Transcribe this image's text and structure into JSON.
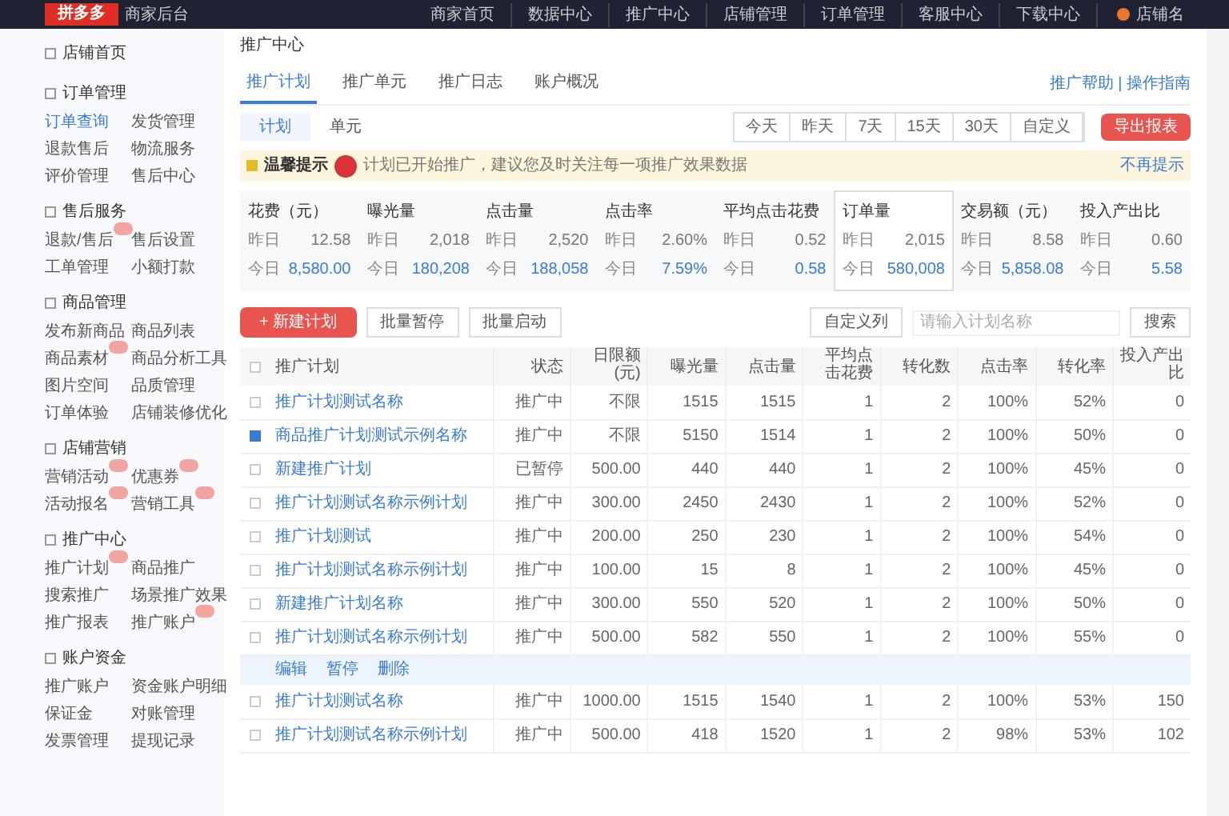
{
  "topbar": {
    "logo": "拼多多",
    "subtitle": "商家后台",
    "nav": [
      "商家首页",
      "数据中心",
      "推广中心",
      "店铺管理",
      "订单管理",
      "客服中心",
      "下载中心"
    ],
    "user": "店铺名"
  },
  "sidebar": {
    "groups": [
      {
        "title": "店铺首页"
      },
      {
        "title": "订单管理",
        "items": [
          {
            "label": "订单查询",
            "selected": true,
            "badge": false
          },
          {
            "label": "发货管理",
            "selected": false,
            "badge": false
          },
          {
            "label": "退款售后",
            "selected": false,
            "badge": false
          },
          {
            "label": "物流服务",
            "selected": false,
            "badge": false
          },
          {
            "label": "评价管理",
            "selected": false,
            "badge": false
          },
          {
            "label": "售后中心",
            "selected": false,
            "badge": false
          }
        ]
      },
      {
        "title": "售后服务",
        "items": [
          {
            "label": "退款/售后",
            "selected": false,
            "badge": true
          },
          {
            "label": "售后设置",
            "selected": false,
            "badge": false
          },
          {
            "label": "工单管理",
            "selected": false,
            "badge": false
          },
          {
            "label": "小额打款",
            "selected": false,
            "badge": false
          }
        ]
      },
      {
        "title": "商品管理",
        "items": [
          {
            "label": "发布新商品",
            "selected": false,
            "badge": false
          },
          {
            "label": "商品列表",
            "selected": false,
            "badge": false
          },
          {
            "label": "商品素材",
            "selected": false,
            "badge": true
          },
          {
            "label": "商品分析工具",
            "selected": false,
            "badge": false
          },
          {
            "label": "图片空间",
            "selected": false,
            "badge": false
          },
          {
            "label": "品质管理",
            "selected": false,
            "badge": false
          },
          {
            "label": "订单体验",
            "selected": false,
            "badge": false
          },
          {
            "label": "店铺装修优化",
            "selected": false,
            "badge": false
          }
        ]
      },
      {
        "title": "店铺营销",
        "items": [
          {
            "label": "营销活动",
            "selected": false,
            "badge": true
          },
          {
            "label": "优惠券",
            "selected": false,
            "badge": true
          },
          {
            "label": "活动报名",
            "selected": false,
            "badge": true
          },
          {
            "label": "营销工具",
            "selected": false,
            "badge": true
          }
        ]
      },
      {
        "title": "推广中心",
        "items": [
          {
            "label": "推广计划",
            "selected": false,
            "badge": true
          },
          {
            "label": "商品推广",
            "selected": false,
            "badge": false
          },
          {
            "label": "搜索推广",
            "selected": false,
            "badge": false
          },
          {
            "label": "场景推广效果",
            "selected": false,
            "badge": false
          },
          {
            "label": "推广报表",
            "selected": false,
            "badge": false
          },
          {
            "label": "推广账户",
            "selected": false,
            "badge": true
          }
        ]
      },
      {
        "title": "账户资金",
        "items": [
          {
            "label": "推广账户",
            "selected": false,
            "badge": false
          },
          {
            "label": "资金账户明细",
            "selected": false,
            "badge": false
          },
          {
            "label": "保证金",
            "selected": false,
            "badge": false
          },
          {
            "label": "对账管理",
            "selected": false,
            "badge": false
          },
          {
            "label": "发票管理",
            "selected": false,
            "badge": false
          },
          {
            "label": "提现记录",
            "selected": false,
            "badge": false
          }
        ]
      }
    ]
  },
  "breadcrumb": "推广中心",
  "tabs": [
    {
      "label": "推广计划",
      "selected": true
    },
    {
      "label": "推广单元",
      "selected": false
    },
    {
      "label": "推广日志",
      "selected": false
    },
    {
      "label": "账户概况",
      "selected": false
    }
  ],
  "help_link": "推广帮助 | 操作指南",
  "subtabs": [
    {
      "label": "计划",
      "selected": true
    },
    {
      "label": "单元",
      "selected": false
    }
  ],
  "date_ranges": [
    {
      "label": "今天",
      "selected": false
    },
    {
      "label": "昨天",
      "selected": false
    },
    {
      "label": "7天",
      "selected": false
    },
    {
      "label": "15天",
      "selected": false
    },
    {
      "label": "30天",
      "selected": false
    },
    {
      "label": "自定义",
      "selected": false
    }
  ],
  "export_button": "导出报表",
  "notice": {
    "title": "温馨提示",
    "text": "计划已开始推广，建议您及时关注每一项推广效果数据",
    "dismiss": "不再提示"
  },
  "metrics": [
    {
      "label": "花费（元）",
      "yesterday_label": "昨日",
      "yesterday": "12.58",
      "today_label": "今日",
      "today": "8,580.00",
      "selected": false
    },
    {
      "label": "曝光量",
      "yesterday_label": "昨日",
      "yesterday": "2,018",
      "today_label": "今日",
      "today": "180,208",
      "selected": false
    },
    {
      "label": "点击量",
      "yesterday_label": "昨日",
      "yesterday": "2,520",
      "today_label": "今日",
      "today": "188,058",
      "selected": false
    },
    {
      "label": "点击率",
      "yesterday_label": "昨日",
      "yesterday": "2.60%",
      "today_label": "今日",
      "today": "7.59%",
      "selected": false
    },
    {
      "label": "平均点击花费",
      "yesterday_label": "昨日",
      "yesterday": "0.52",
      "today_label": "今日",
      "today": "0.58",
      "selected": false
    },
    {
      "label": "订单量",
      "yesterday_label": "昨日",
      "yesterday": "2,015",
      "today_label": "今日",
      "today": "580,008",
      "selected": true
    },
    {
      "label": "交易额（元）",
      "yesterday_label": "昨日",
      "yesterday": "8.58",
      "today_label": "今日",
      "today": "5,858.08",
      "selected": false
    },
    {
      "label": "投入产出比",
      "yesterday_label": "昨日",
      "yesterday": "0.60",
      "today_label": "今日",
      "today": "5.58",
      "selected": false
    }
  ],
  "toolbar": {
    "new_button": "+ 新建计划",
    "buttons": [
      "批量暂停",
      "批量启动"
    ],
    "columns_button": "自定义列",
    "search": {
      "placeholder": "请输入计划名称"
    },
    "search_button": "搜索"
  },
  "table": {
    "header_checked": false,
    "columns": [
      "推广计划",
      "状态",
      "日限额(元)",
      "曝光量",
      "点击量",
      "平均点击花费",
      "转化数",
      "点击率",
      "转化率",
      "投入产出比"
    ],
    "rows": [
      {
        "kind": "data",
        "checked": false,
        "cells": [
          "推广计划测试名称",
          "推广中",
          "不限",
          "1515",
          "1515",
          "1",
          "2",
          "100%",
          "52%",
          "0"
        ]
      },
      {
        "kind": "data",
        "checked": true,
        "cells": [
          "商品推广计划测试示例名称",
          "推广中",
          "不限",
          "5150",
          "1514",
          "1",
          "2",
          "100%",
          "50%",
          "0"
        ]
      },
      {
        "kind": "data",
        "checked": false,
        "cells": [
          "新建推广计划",
          "已暂停",
          "500.00",
          "440",
          "440",
          "1",
          "2",
          "100%",
          "45%",
          "0"
        ]
      },
      {
        "kind": "data",
        "checked": false,
        "cells": [
          "推广计划测试名称示例计划",
          "推广中",
          "300.00",
          "2450",
          "2430",
          "1",
          "2",
          "100%",
          "52%",
          "0"
        ]
      },
      {
        "kind": "data",
        "checked": false,
        "cells": [
          "推广计划测试",
          "推广中",
          "200.00",
          "250",
          "230",
          "1",
          "2",
          "100%",
          "54%",
          "0"
        ]
      },
      {
        "kind": "data",
        "checked": false,
        "cells": [
          "推广计划测试名称示例计划",
          "推广中",
          "100.00",
          "15",
          "8",
          "1",
          "2",
          "100%",
          "45%",
          "0"
        ]
      },
      {
        "kind": "data",
        "checked": false,
        "cells": [
          "新建推广计划名称",
          "推广中",
          "300.00",
          "550",
          "520",
          "1",
          "2",
          "100%",
          "50%",
          "0"
        ]
      },
      {
        "kind": "data",
        "checked": false,
        "cells": [
          "推广计划测试名称示例计划",
          "推广中",
          "500.00",
          "582",
          "550",
          "1",
          "2",
          "100%",
          "55%",
          "0"
        ]
      },
      {
        "kind": "actions",
        "actions": [
          "编辑",
          "暂停",
          "删除"
        ]
      },
      {
        "kind": "data",
        "checked": false,
        "cells": [
          "推广计划测试名称",
          "推广中",
          "1000.00",
          "1515",
          "1540",
          "1",
          "2",
          "100%",
          "53%",
          "150"
        ]
      },
      {
        "kind": "data",
        "checked": false,
        "cells": [
          "推广计划测试名称示例计划",
          "推广中",
          "500.00",
          "418",
          "1520",
          "1",
          "2",
          "98%",
          "53%",
          "102"
        ]
      }
    ]
  }
}
